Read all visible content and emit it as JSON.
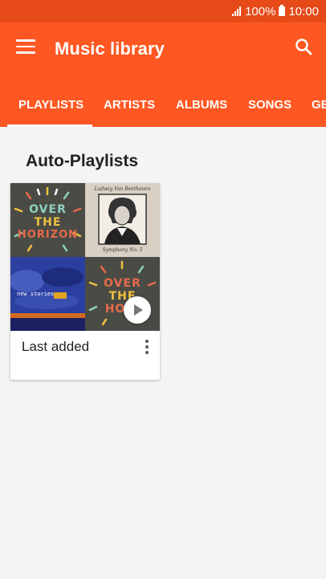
{
  "status_bar": {
    "battery_text": "100%",
    "time": "10:00",
    "icons": [
      "signal-icon",
      "battery-icon"
    ]
  },
  "app_bar": {
    "title": "Music library",
    "menu_icon": "menu-icon",
    "search_icon": "search-icon",
    "background": "#ff5722"
  },
  "tabs": [
    {
      "label": "PLAYLISTS",
      "active": true
    },
    {
      "label": "ARTISTS",
      "active": false
    },
    {
      "label": "ALBUMS",
      "active": false
    },
    {
      "label": "SONGS",
      "active": false
    },
    {
      "label": "GE",
      "active": false
    }
  ],
  "section": {
    "title": "Auto-Playlists"
  },
  "playlist_card": {
    "label": "Last added",
    "album_art": {
      "top_left_text": [
        "OVER",
        "THE",
        "HORIZON"
      ],
      "top_right_caption_top": "Ludwig Van Beethoven",
      "top_right_caption_bottom": "Symphony No. 5",
      "bottom_left_text": "new stories",
      "bottom_right_text": [
        "OVER",
        "THE",
        "HORI"
      ]
    },
    "play_icon": "play-icon",
    "more_icon": "more-vertical-icon"
  }
}
